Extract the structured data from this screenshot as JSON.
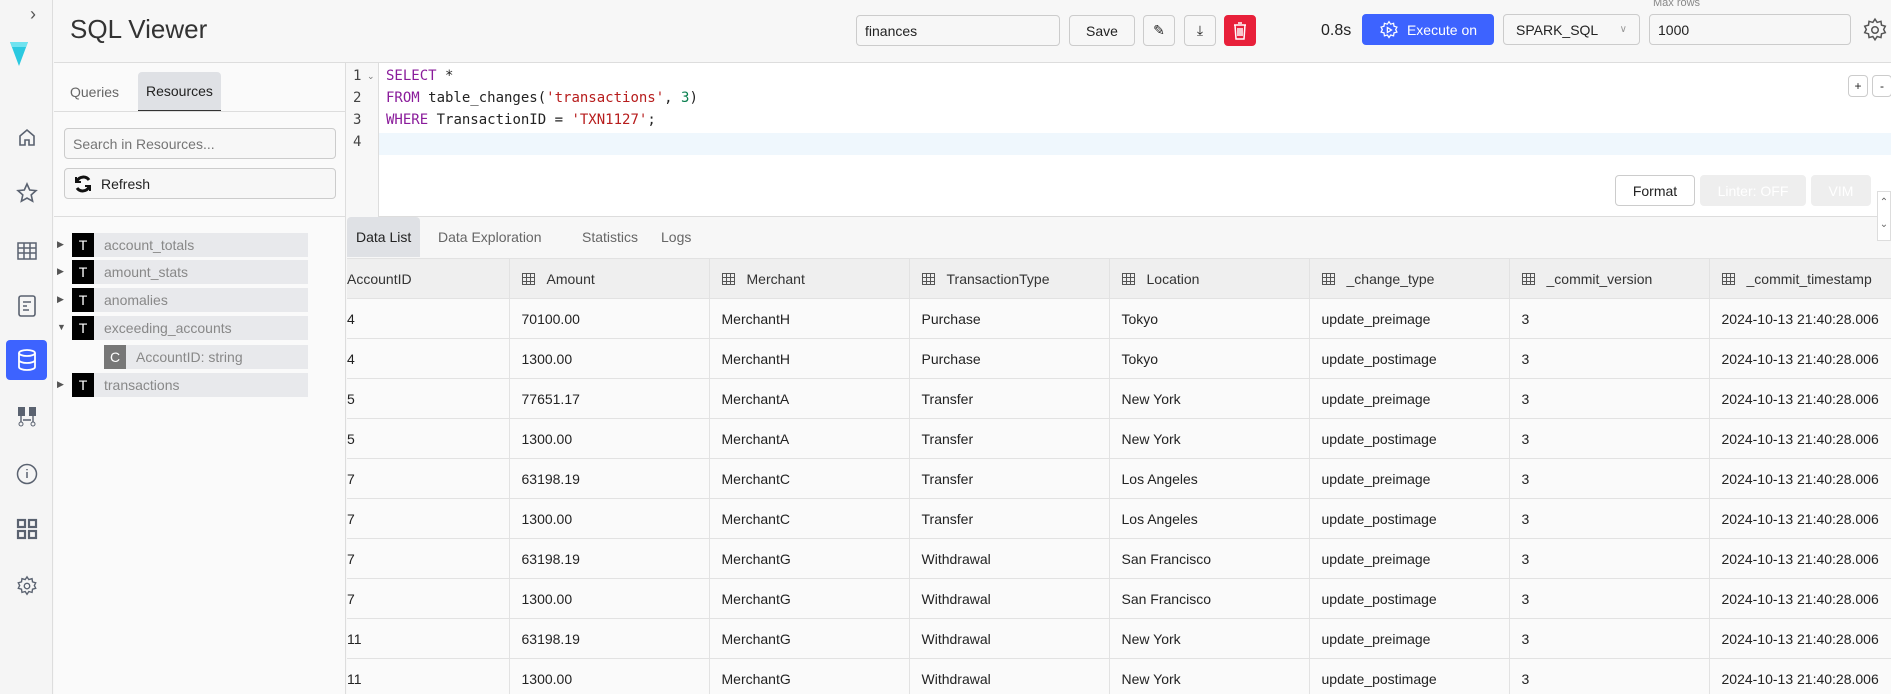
{
  "header": {
    "title": "SQL Viewer",
    "query_name": "finances",
    "save_label": "Save",
    "elapsed": "0.8s",
    "execute_label": "Execute on",
    "engine": "SPARK_SQL",
    "max_rows_label": "Max rows",
    "max_rows": "1000"
  },
  "left_panel": {
    "tabs": [
      {
        "label": "Queries"
      },
      {
        "label": "Resources"
      }
    ],
    "search_placeholder": "Search in Resources...",
    "refresh_label": "Refresh",
    "tree": [
      {
        "badge": "T",
        "label": "account_totals"
      },
      {
        "badge": "T",
        "label": "amount_stats"
      },
      {
        "badge": "T",
        "label": "anomalies"
      },
      {
        "badge": "T",
        "label": "exceeding_accounts"
      },
      {
        "badge": "C",
        "label": "AccountID: string"
      },
      {
        "badge": "T",
        "label": "transactions"
      }
    ]
  },
  "editor": {
    "line_numbers": [
      "1",
      "2",
      "3",
      "4"
    ],
    "l1": {
      "kw": "SELECT",
      "rest": " *"
    },
    "l2": {
      "kw": "FROM",
      "a": " table_changes(",
      "s": "'transactions'",
      "b": ", ",
      "n": "3",
      "c": ")"
    },
    "l3": {
      "kw": "WHERE",
      "a": " TransactionID = ",
      "s": "'TXN1127'",
      "c": ";"
    },
    "zoom_in": "+",
    "zoom_out": "-",
    "format_label": "Format",
    "linter_label": "Linter: OFF",
    "vim_label": "VIM"
  },
  "result_tabs": [
    {
      "label": "Data List"
    },
    {
      "label": "Data Exploration"
    },
    {
      "label": "Statistics"
    },
    {
      "label": "Logs"
    }
  ],
  "table": {
    "columns": [
      "AccountID",
      "Amount",
      "Merchant",
      "TransactionType",
      "Location",
      "_change_type",
      "_commit_version",
      "_commit_timestamp"
    ],
    "rows": [
      [
        "4",
        "70100.00",
        "MerchantH",
        "Purchase",
        "Tokyo",
        "update_preimage",
        "3",
        "2024-10-13 21:40:28.006"
      ],
      [
        "4",
        "1300.00",
        "MerchantH",
        "Purchase",
        "Tokyo",
        "update_postimage",
        "3",
        "2024-10-13 21:40:28.006"
      ],
      [
        "5",
        "77651.17",
        "MerchantA",
        "Transfer",
        "New York",
        "update_preimage",
        "3",
        "2024-10-13 21:40:28.006"
      ],
      [
        "5",
        "1300.00",
        "MerchantA",
        "Transfer",
        "New York",
        "update_postimage",
        "3",
        "2024-10-13 21:40:28.006"
      ],
      [
        "7",
        "63198.19",
        "MerchantC",
        "Transfer",
        "Los Angeles",
        "update_preimage",
        "3",
        "2024-10-13 21:40:28.006"
      ],
      [
        "7",
        "1300.00",
        "MerchantC",
        "Transfer",
        "Los Angeles",
        "update_postimage",
        "3",
        "2024-10-13 21:40:28.006"
      ],
      [
        "7",
        "63198.19",
        "MerchantG",
        "Withdrawal",
        "San Francisco",
        "update_preimage",
        "3",
        "2024-10-13 21:40:28.006"
      ],
      [
        "7",
        "1300.00",
        "MerchantG",
        "Withdrawal",
        "San Francisco",
        "update_postimage",
        "3",
        "2024-10-13 21:40:28.006"
      ],
      [
        "11",
        "63198.19",
        "MerchantG",
        "Withdrawal",
        "New York",
        "update_preimage",
        "3",
        "2024-10-13 21:40:28.006"
      ],
      [
        "11",
        "1300.00",
        "MerchantG",
        "Withdrawal",
        "New York",
        "update_postimage",
        "3",
        "2024-10-13 21:40:28.006"
      ]
    ]
  },
  "colors": {
    "accent": "#3d63ff",
    "danger": "#e8203a",
    "logo": "#2bc9e0"
  }
}
